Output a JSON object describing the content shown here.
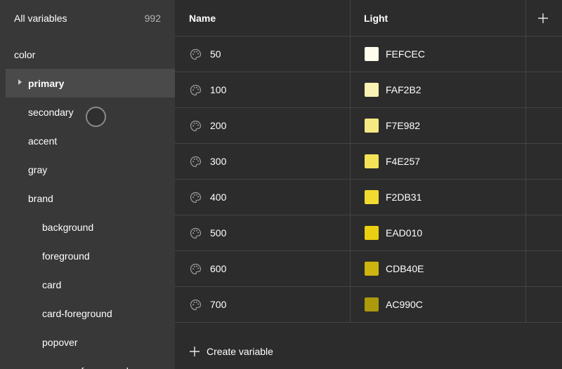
{
  "sidebar": {
    "title": "All variables",
    "count": "992",
    "items": [
      {
        "label": "color"
      },
      {
        "label": "primary"
      },
      {
        "label": "secondary"
      },
      {
        "label": "accent"
      },
      {
        "label": "gray"
      },
      {
        "label": "brand"
      },
      {
        "label": "background"
      },
      {
        "label": "foreground"
      },
      {
        "label": "card"
      },
      {
        "label": "card-foreground"
      },
      {
        "label": "popover"
      },
      {
        "label": "popover-foreground"
      }
    ]
  },
  "table": {
    "columns": {
      "name": "Name",
      "mode": "Light"
    },
    "add_column_icon": "plus-icon",
    "rows": [
      {
        "name": "50",
        "value": "FEFCEC",
        "color": "#FEFCEC"
      },
      {
        "name": "100",
        "value": "FAF2B2",
        "color": "#FAF2B2"
      },
      {
        "name": "200",
        "value": "F7E982",
        "color": "#F7E982"
      },
      {
        "name": "300",
        "value": "F4E257",
        "color": "#F4E257"
      },
      {
        "name": "400",
        "value": "F2DB31",
        "color": "#F2DB31"
      },
      {
        "name": "500",
        "value": "EAD010",
        "color": "#EAD010"
      },
      {
        "name": "600",
        "value": "CDB40E",
        "color": "#CDB40E"
      },
      {
        "name": "700",
        "value": "AC990C",
        "color": "#AC990C"
      }
    ],
    "row_icon": "color-palette-icon"
  },
  "footer": {
    "create_label": "Create variable"
  }
}
